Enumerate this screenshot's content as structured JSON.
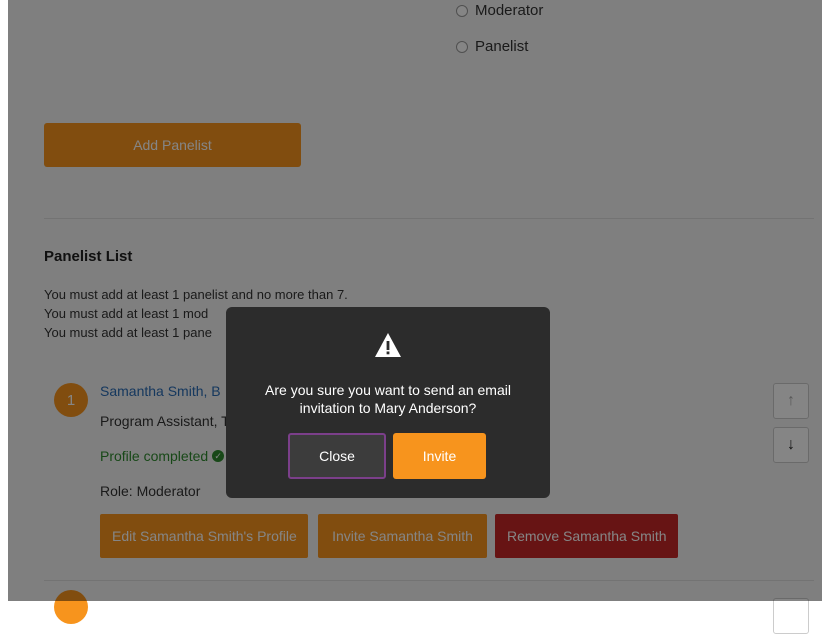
{
  "roles": {
    "moderator_label": "Moderator",
    "panelist_label": "Panelist"
  },
  "add_button_label": "Add Panelist",
  "panelist_list": {
    "title": "Panelist List",
    "requirements": [
      "You must add at least 1 panelist and no more than 7.",
      "You must add at least 1 mod",
      "You must add at least 1 pane"
    ],
    "items": [
      {
        "number": "1",
        "name": "Samantha Smith, B",
        "title": "Program Assistant, T",
        "status": "Profile completed",
        "role": "Role: Moderator",
        "edit_label": "Edit Samantha Smith's Profile",
        "invite_label": "Invite Samantha Smith",
        "remove_label": "Remove Samantha Smith",
        "move_up_icon": "↑",
        "move_down_icon": "↓"
      }
    ]
  },
  "modal": {
    "icon": "warning-triangle-icon",
    "message": "Are you sure you want to send an email invitation to Mary Anderson?",
    "close_label": "Close",
    "invite_label": "Invite"
  },
  "colors": {
    "accent_orange": "#f7941d",
    "danger_red": "#c62828",
    "success_green": "#2e8b2e",
    "modal_bg": "#2c2c2c",
    "focus_ring": "#7b3f8a"
  }
}
